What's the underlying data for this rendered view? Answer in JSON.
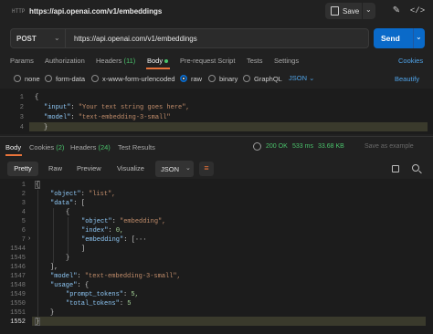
{
  "window": {
    "title": "https://api.openai.com/v1/embeddings",
    "protocol_badge": "HTTP"
  },
  "toolbar": {
    "save_label": "Save"
  },
  "request": {
    "method": "POST",
    "url": "https://api.openai.com/v1/embeddings",
    "send_label": "Send"
  },
  "request_tabs": [
    {
      "label": "Params"
    },
    {
      "label": "Authorization"
    },
    {
      "label": "Headers",
      "count": "(11)"
    },
    {
      "label": "Body"
    },
    {
      "label": "Pre-request Script"
    },
    {
      "label": "Tests"
    },
    {
      "label": "Settings"
    }
  ],
  "cookies_label": "Cookies",
  "body_types": [
    {
      "label": "none"
    },
    {
      "label": "form-data"
    },
    {
      "label": "x-www-form-urlencoded"
    },
    {
      "label": "raw"
    },
    {
      "label": "binary"
    },
    {
      "label": "GraphQL"
    }
  ],
  "body_format": "JSON",
  "beautify_label": "Beautify",
  "request_body": {
    "line_numbers": [
      "1",
      "2",
      "3",
      "4"
    ],
    "lines": [
      "{",
      "\"input\": \"Your text string goes here\",",
      "\"model\": \"text-embedding-3-small\"",
      "}"
    ]
  },
  "response_tabs": [
    {
      "label": "Body"
    },
    {
      "label": "Cookies",
      "count": "(2)"
    },
    {
      "label": "Headers",
      "count": "(24)"
    },
    {
      "label": "Test Results"
    }
  ],
  "response_status": {
    "code": "200 OK",
    "time": "533 ms",
    "size": "33.68 KB"
  },
  "save_example_label": "Save as example",
  "view_modes": [
    "Pretty",
    "Raw",
    "Preview",
    "Visualize"
  ],
  "response_format": "JSON",
  "response_body": {
    "line_numbers": [
      "1",
      "2",
      "3",
      "4",
      "5",
      "6",
      "7",
      "1544",
      "1545",
      "1546",
      "1547",
      "1548",
      "1549",
      "1550",
      "1551",
      "1552"
    ],
    "lines": [
      "{",
      "\"object\": \"list\",",
      "\"data\": [",
      "{",
      "\"object\": \"embedding\",",
      "\"index\": 0,",
      "\"embedding\": [···",
      "]",
      "}",
      "],",
      "\"model\": \"text-embedding-3-small\",",
      "\"usage\": {",
      "\"prompt_tokens\": 5,",
      "\"total_tokens\": 5",
      "}",
      "}"
    ]
  },
  "colors": {
    "accent": "#e8733a",
    "send": "#0a6ac9",
    "link": "#4fa3e8",
    "success": "#4ac26b"
  }
}
